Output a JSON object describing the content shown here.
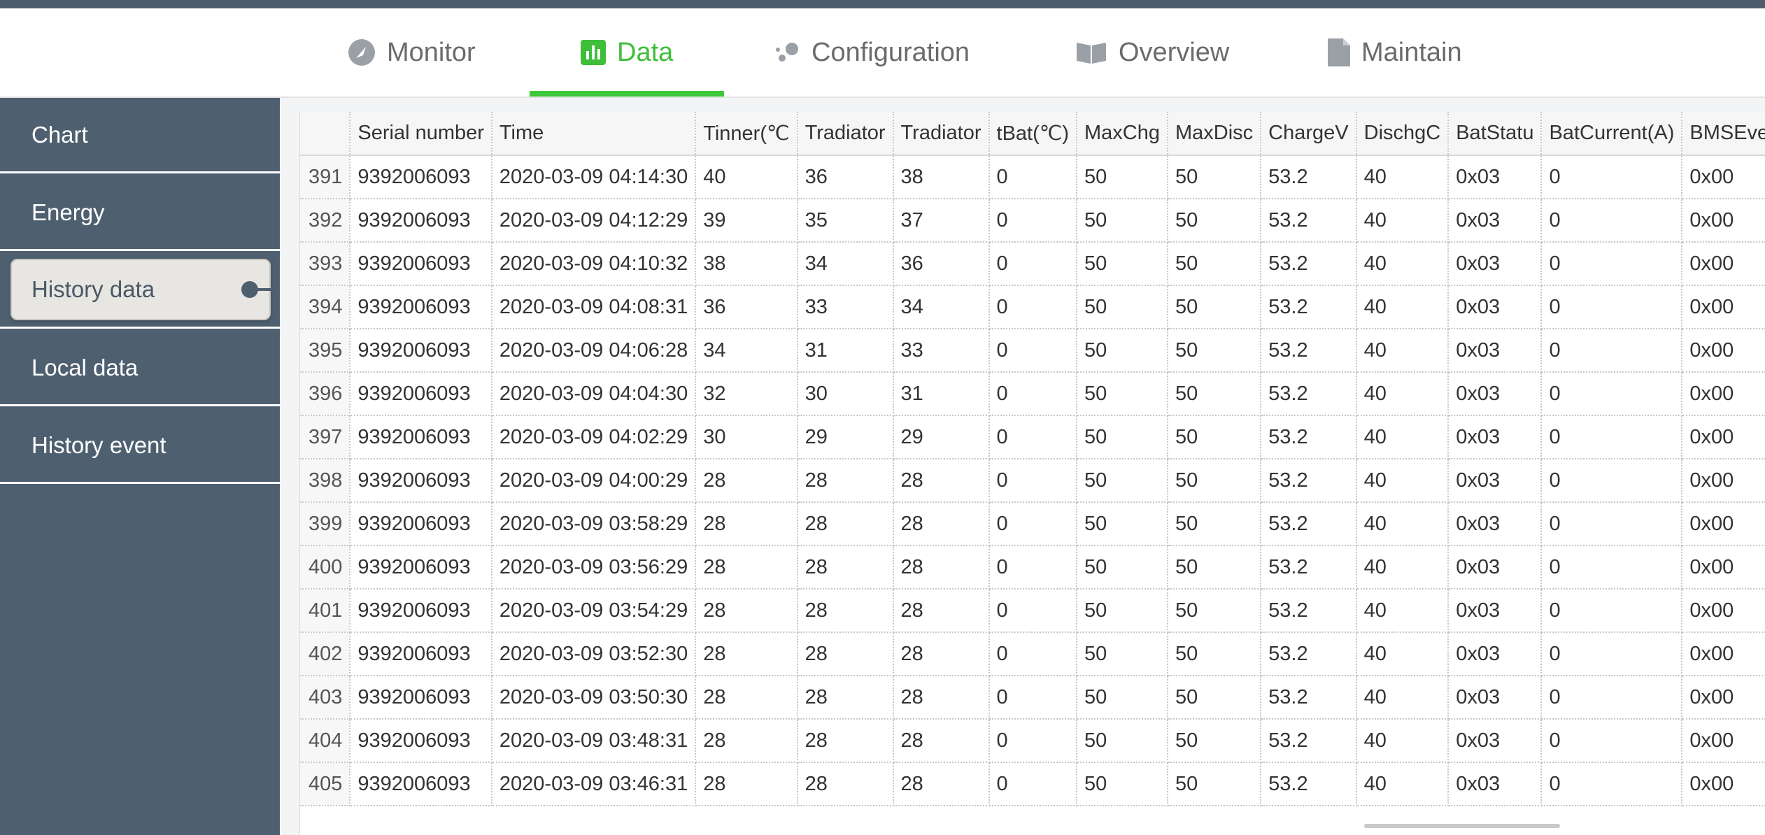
{
  "tabs": [
    {
      "label": "Monitor",
      "icon": "gauge-icon"
    },
    {
      "label": "Data",
      "icon": "bar-chart-icon"
    },
    {
      "label": "Configuration",
      "icon": "settings-dots-icon"
    },
    {
      "label": "Overview",
      "icon": "book-icon"
    },
    {
      "label": "Maintain",
      "icon": "document-icon"
    }
  ],
  "sidebar": {
    "items": [
      {
        "label": "Chart"
      },
      {
        "label": "Energy"
      },
      {
        "label": "History data"
      },
      {
        "label": "Local data"
      },
      {
        "label": "History event"
      }
    ]
  },
  "table": {
    "headers": [
      "",
      "Serial number",
      "Time",
      "Tinner(℃",
      "Tradiator",
      "Tradiator",
      "tBat(℃)",
      "MaxChg",
      "MaxDisc",
      "ChargeV",
      "DischgC",
      "BatStatu",
      "BatCurrent(A)",
      "BMSEvent"
    ],
    "rows": [
      [
        "391",
        "9392006093",
        "2020-03-09 04:14:30",
        "40",
        "36",
        "38",
        "0",
        "50",
        "50",
        "53.2",
        "40",
        "0x03",
        "0",
        "0x00"
      ],
      [
        "392",
        "9392006093",
        "2020-03-09 04:12:29",
        "39",
        "35",
        "37",
        "0",
        "50",
        "50",
        "53.2",
        "40",
        "0x03",
        "0",
        "0x00"
      ],
      [
        "393",
        "9392006093",
        "2020-03-09 04:10:32",
        "38",
        "34",
        "36",
        "0",
        "50",
        "50",
        "53.2",
        "40",
        "0x03",
        "0",
        "0x00"
      ],
      [
        "394",
        "9392006093",
        "2020-03-09 04:08:31",
        "36",
        "33",
        "34",
        "0",
        "50",
        "50",
        "53.2",
        "40",
        "0x03",
        "0",
        "0x00"
      ],
      [
        "395",
        "9392006093",
        "2020-03-09 04:06:28",
        "34",
        "31",
        "33",
        "0",
        "50",
        "50",
        "53.2",
        "40",
        "0x03",
        "0",
        "0x00"
      ],
      [
        "396",
        "9392006093",
        "2020-03-09 04:04:30",
        "32",
        "30",
        "31",
        "0",
        "50",
        "50",
        "53.2",
        "40",
        "0x03",
        "0",
        "0x00"
      ],
      [
        "397",
        "9392006093",
        "2020-03-09 04:02:29",
        "30",
        "29",
        "29",
        "0",
        "50",
        "50",
        "53.2",
        "40",
        "0x03",
        "0",
        "0x00"
      ],
      [
        "398",
        "9392006093",
        "2020-03-09 04:00:29",
        "28",
        "28",
        "28",
        "0",
        "50",
        "50",
        "53.2",
        "40",
        "0x03",
        "0",
        "0x00"
      ],
      [
        "399",
        "9392006093",
        "2020-03-09 03:58:29",
        "28",
        "28",
        "28",
        "0",
        "50",
        "50",
        "53.2",
        "40",
        "0x03",
        "0",
        "0x00"
      ],
      [
        "400",
        "9392006093",
        "2020-03-09 03:56:29",
        "28",
        "28",
        "28",
        "0",
        "50",
        "50",
        "53.2",
        "40",
        "0x03",
        "0",
        "0x00"
      ],
      [
        "401",
        "9392006093",
        "2020-03-09 03:54:29",
        "28",
        "28",
        "28",
        "0",
        "50",
        "50",
        "53.2",
        "40",
        "0x03",
        "0",
        "0x00"
      ],
      [
        "402",
        "9392006093",
        "2020-03-09 03:52:30",
        "28",
        "28",
        "28",
        "0",
        "50",
        "50",
        "53.2",
        "40",
        "0x03",
        "0",
        "0x00"
      ],
      [
        "403",
        "9392006093",
        "2020-03-09 03:50:30",
        "28",
        "28",
        "28",
        "0",
        "50",
        "50",
        "53.2",
        "40",
        "0x03",
        "0",
        "0x00"
      ],
      [
        "404",
        "9392006093",
        "2020-03-09 03:48:31",
        "28",
        "28",
        "28",
        "0",
        "50",
        "50",
        "53.2",
        "40",
        "0x03",
        "0",
        "0x00"
      ],
      [
        "405",
        "9392006093",
        "2020-03-09 03:46:31",
        "28",
        "28",
        "28",
        "0",
        "50",
        "50",
        "53.2",
        "40",
        "0x03",
        "0",
        "0x00"
      ]
    ]
  },
  "colors": {
    "accent": "#3fc93a",
    "sidebar": "#4e6070",
    "topbar": "#4d5d6b"
  }
}
